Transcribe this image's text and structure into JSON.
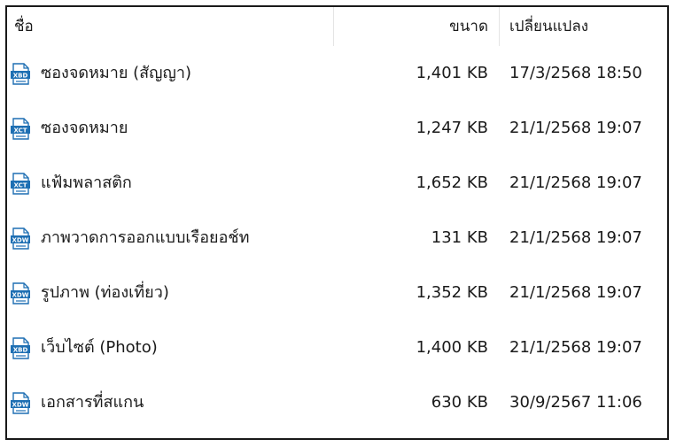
{
  "columns": {
    "name": "ชื่อ",
    "size": "ขนาด",
    "modified": "เปลี่ยนแปลง"
  },
  "colors": {
    "icon_blue": "#1e6fb3",
    "text": "#1a1a1a",
    "header_separator": "#e5e5e5"
  },
  "files": [
    {
      "name": "ซองจดหมาย (สัญญา)",
      "size": "1,401 KB",
      "modified": "17/3/2568 18:50",
      "icon": "xbd-file-icon",
      "ext": "XBD"
    },
    {
      "name": "ซองจดหมาย",
      "size": "1,247 KB",
      "modified": "21/1/2568 19:07",
      "icon": "xct-file-icon",
      "ext": "XCT"
    },
    {
      "name": "แฟ้มพลาสติก",
      "size": "1,652 KB",
      "modified": "21/1/2568 19:07",
      "icon": "xct-file-icon",
      "ext": "XCT"
    },
    {
      "name": "ภาพวาดการออกแบบเรือยอช์ท",
      "size": "131 KB",
      "modified": "21/1/2568 19:07",
      "icon": "xdw-file-icon",
      "ext": "XDW"
    },
    {
      "name": "รูปภาพ (ท่องเที่ยว)",
      "size": "1,352 KB",
      "modified": "21/1/2568 19:07",
      "icon": "xdw-file-icon",
      "ext": "XDW"
    },
    {
      "name": "เว็บไซต์ (Photo)",
      "size": "1,400 KB",
      "modified": "21/1/2568 19:07",
      "icon": "xbd-file-icon",
      "ext": "XBD"
    },
    {
      "name": "เอกสารที่สแกน",
      "size": "630 KB",
      "modified": "30/9/2567 11:06",
      "icon": "xdw-file-icon",
      "ext": "XDW"
    }
  ]
}
